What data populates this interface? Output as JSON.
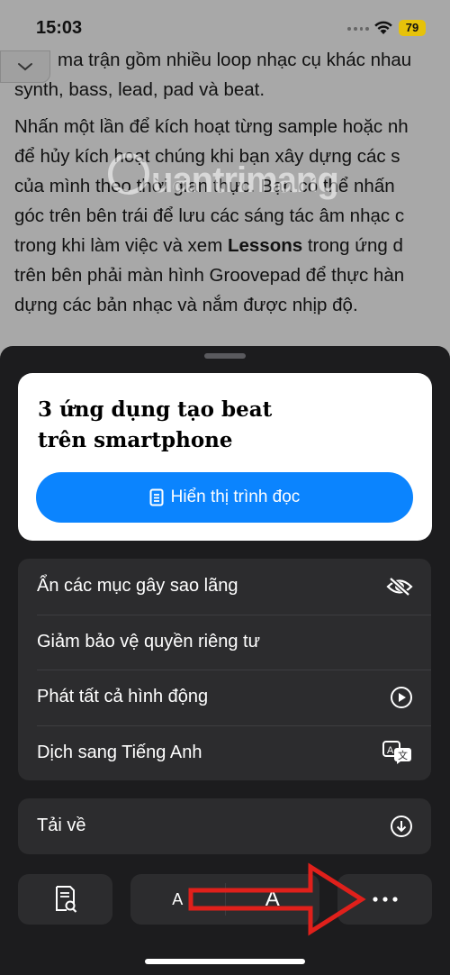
{
  "status_bar": {
    "time": "15:03",
    "battery": "79",
    "battery_color": "#e6c20a"
  },
  "article": {
    "line1": "ma trận gồm nhiều loop nhạc cụ khác nhau",
    "line2": "synth, bass, lead, pad và beat.",
    "p2_line1": "Nhấn một lần để kích hoạt từng sample hoặc nh",
    "p2_line2": "để hủy kích hoạt chúng khi bạn xây dựng các s",
    "p2_line3": "của mình theo thời gian thực. Bạn có thể nhấn",
    "p2_line4": "góc trên bên trái để lưu các sáng tác âm nhạc c",
    "p2_line5_pre": "trong khi làm việc và xem ",
    "p2_line5_bold": "Lessons",
    "p2_line5_post": " trong ứng d",
    "p2_line6": "trên bên phải màn hình Groovepad để thực hàn",
    "p2_line7": "dựng các bản nhạc và nắm được nhịp độ.",
    "watermark": "uantrimang",
    "collapse_icon": "chevron-down-icon"
  },
  "sheet": {
    "card": {
      "title_line1": "3 ứng dụng tạo beat",
      "title_line2": "trên smartphone",
      "reader_button": "Hiển thị trình đọc",
      "reader_icon": "document-icon"
    },
    "menu": [
      {
        "label": "Ẩn các mục gây sao lãng",
        "icon": "eye-slash-icon"
      },
      {
        "label": "Giảm bảo vệ quyền riêng tư",
        "icon": ""
      },
      {
        "label": "Phát tất cả hình động",
        "icon": "play-circle-icon"
      },
      {
        "label": "Dịch sang Tiếng Anh",
        "icon": "translate-icon"
      }
    ],
    "download": {
      "label": "Tải về",
      "icon": "download-circle-icon"
    },
    "toolbar": {
      "find_icon": "find-in-page-icon",
      "font_small": "A",
      "font_large": "A",
      "more_icon": "ellipsis-icon"
    }
  },
  "annotation": {
    "arrow_color": "#e0201b"
  }
}
